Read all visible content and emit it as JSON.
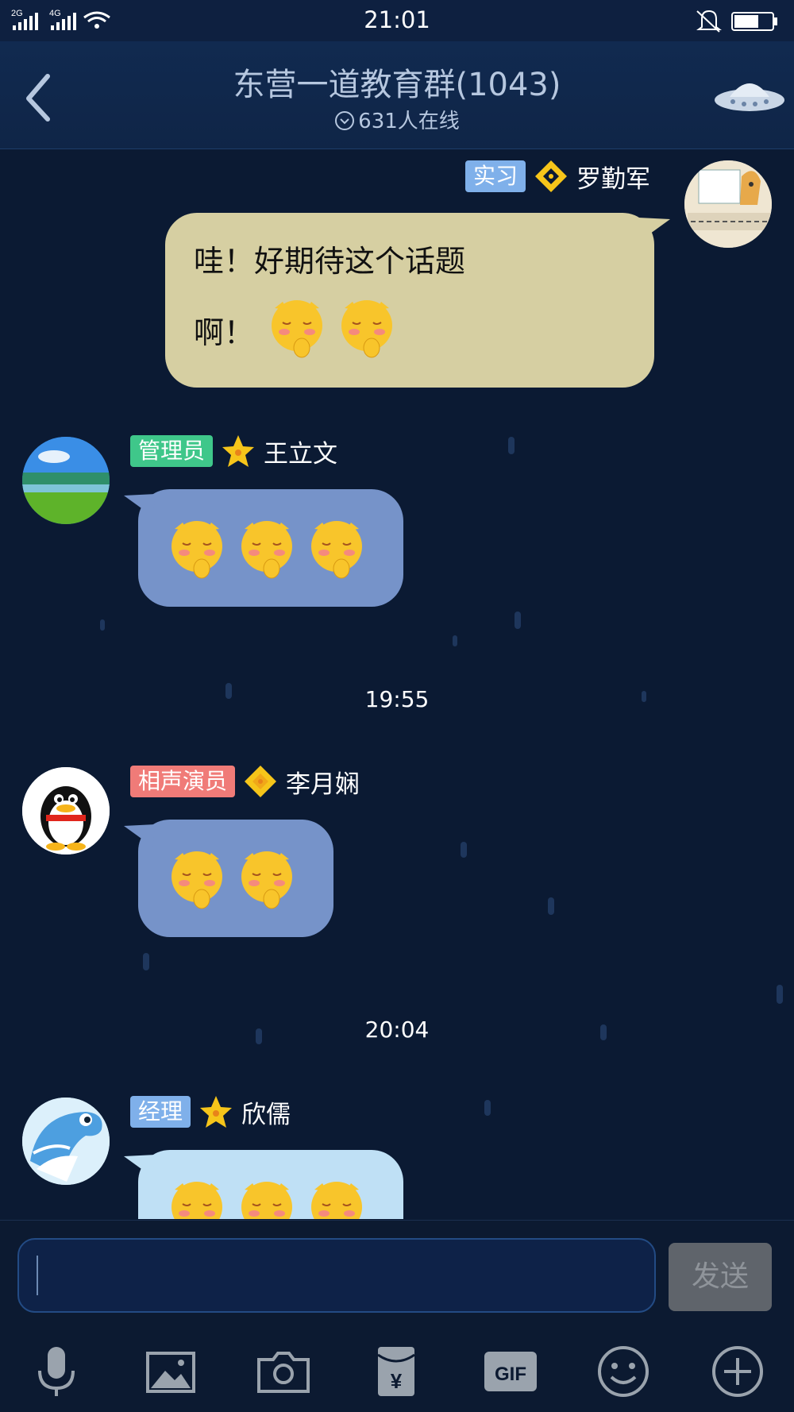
{
  "status": {
    "time": "21:01",
    "net1": "2G",
    "net2": "4G"
  },
  "nav": {
    "title": "东营一道教育群(1043)",
    "online": "631人在线"
  },
  "messages": [
    {
      "tag": "实习",
      "name": "罗勤军",
      "text_line1": "哇！好期待这个话题",
      "text_line2": "啊！"
    },
    {
      "tag": "管理员",
      "name": "王立文"
    },
    {
      "timestamp": "19:55",
      "tag": "相声演员",
      "name": "李月娴"
    },
    {
      "timestamp": "20:04",
      "tag": "经理",
      "name": "欣儒"
    }
  ],
  "input": {
    "send_label": "发送"
  },
  "toolbar": {
    "gif_label": "GIF",
    "yuan_label": "¥"
  },
  "colors": {
    "background": "#0b1a33",
    "bubble_self": "#d6cfa2",
    "bubble_other": "#7693c9",
    "tag_intern": "#7fb0ea",
    "tag_admin": "#3fc78a",
    "tag_actor": "#f07b78"
  }
}
